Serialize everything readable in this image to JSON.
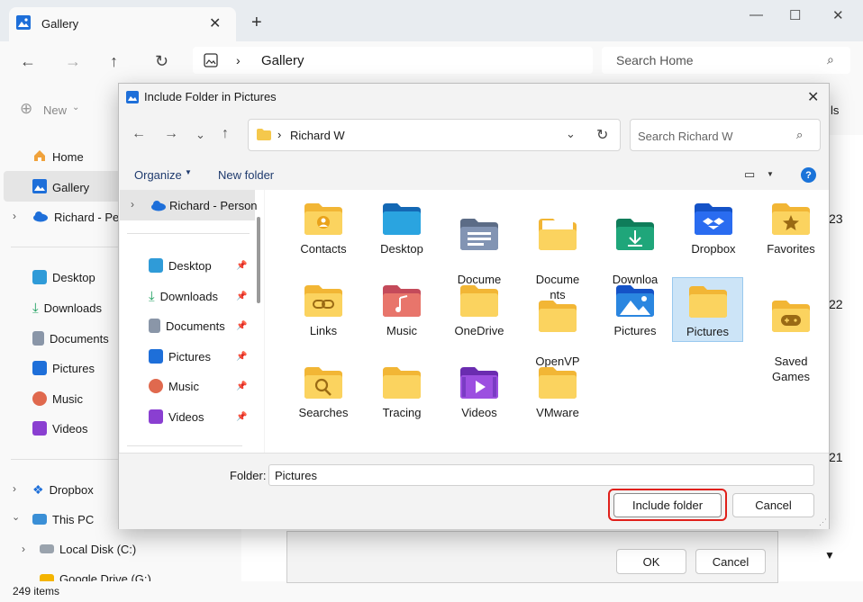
{
  "explorer": {
    "tab_title": "Gallery",
    "address": "Gallery",
    "search_placeholder": "Search Home",
    "new_label": "New",
    "sidebar": {
      "home": "Home",
      "gallery": "Gallery",
      "richard": "Richard - Pers",
      "desktop": "Desktop",
      "downloads": "Downloads",
      "documents": "Documents",
      "pictures": "Pictures",
      "music": "Music",
      "videos": "Videos",
      "dropbox": "Dropbox",
      "thispc": "This PC",
      "localdisk": "Local Disk (C:)",
      "googledrive": "Google Drive (G:)"
    },
    "status": "249 items",
    "right_edge": {
      "ls": "ls",
      "n23": "23",
      "n22": "22",
      "n21": "21"
    },
    "under_ok": "OK",
    "under_cancel": "Cancel"
  },
  "dialog": {
    "title": "Include Folder in Pictures",
    "path": "Richard W",
    "search_placeholder": "Search Richard W",
    "organize": "Organize",
    "new_folder": "New folder",
    "nav_root": "Richard - Person",
    "nav_items": [
      "Desktop",
      "Downloads",
      "Documents",
      "Pictures",
      "Music",
      "Videos"
    ],
    "folders": [
      [
        "Contacts",
        "Desktop",
        "Docume\nnts",
        "Docume\nnts",
        "Downloa\nds",
        "Dropbox",
        "Favorites"
      ],
      [
        "Links",
        "Music",
        "OneDrive",
        "OpenVP\nN",
        "Pictures",
        "Pictures",
        "Saved\nGames"
      ],
      [
        "Searches",
        "Tracing",
        "Videos",
        "VMware"
      ]
    ],
    "folder_label": "Folder:",
    "folder_value": "Pictures",
    "include_button": "Include folder",
    "cancel_button": "Cancel",
    "accent": "#0067c0",
    "highlight": "#e0201b"
  }
}
